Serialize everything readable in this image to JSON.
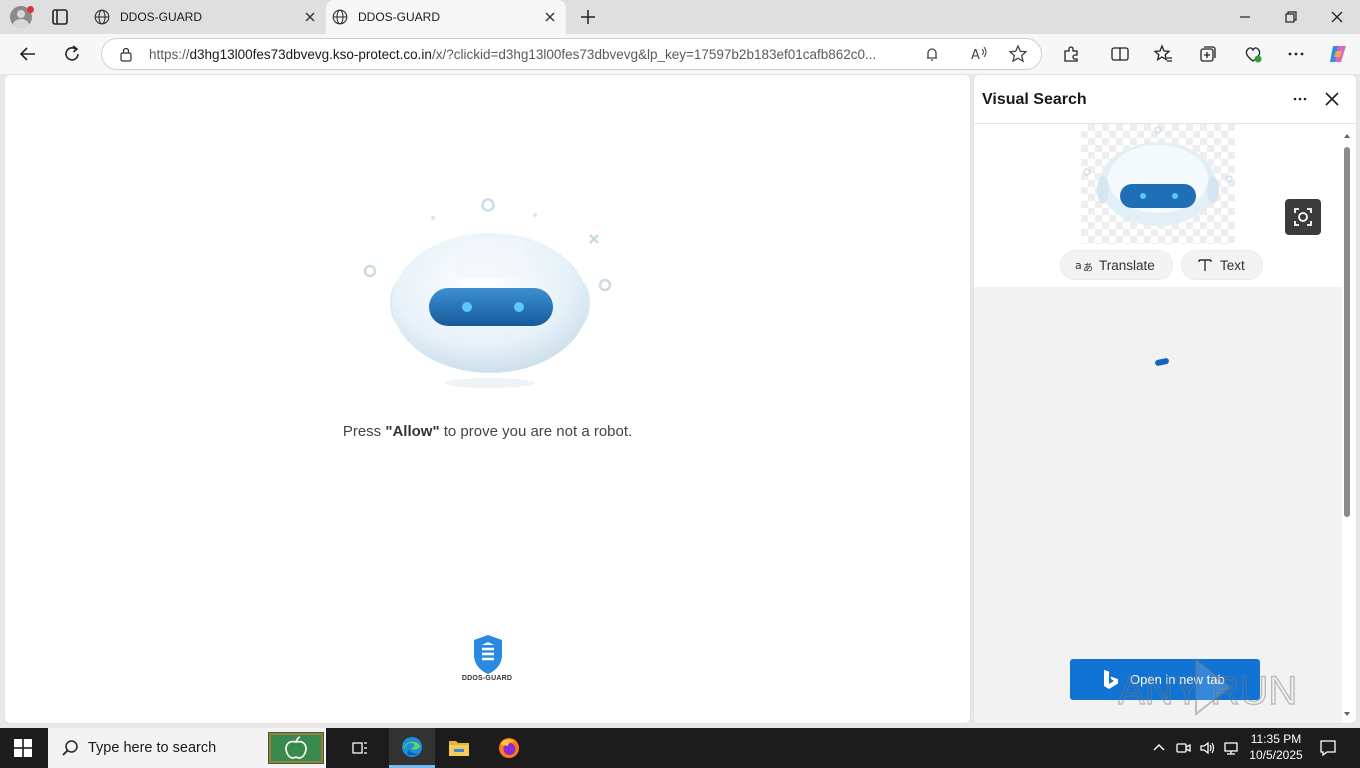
{
  "browser": {
    "tabs": [
      {
        "title": "DDOS-GUARD",
        "active": false
      },
      {
        "title": "DDOS-GUARD",
        "active": true
      }
    ],
    "address": {
      "url_prefix": "https://",
      "url_host": "d3hg13l00fes73dbvevg.kso-protect.co.in",
      "url_rest": "/x/?clickid=d3hg13l00fes73dbvevg&lp_key=17597b2b183ef01cafb862c0..."
    }
  },
  "page": {
    "prompt_before": "Press ",
    "prompt_bold": "\"Allow\"",
    "prompt_after": " to prove you are not a robot.",
    "footer_logo_text": "DDOS-GUARD"
  },
  "visual_search": {
    "title": "Visual Search",
    "chips": [
      {
        "label": "Translate",
        "icon": "translate-icon"
      },
      {
        "label": "Text",
        "icon": "text-icon"
      }
    ],
    "open_button": "Open in new tab"
  },
  "taskbar": {
    "search_placeholder": "Type here to search",
    "time": "11:35 PM",
    "date": "10/5/2025"
  },
  "watermark": "ANY RUN",
  "colors": {
    "accent": "#1173d4",
    "robot_visor": "#1f6fb6",
    "taskbar": "#1c1c1c"
  }
}
